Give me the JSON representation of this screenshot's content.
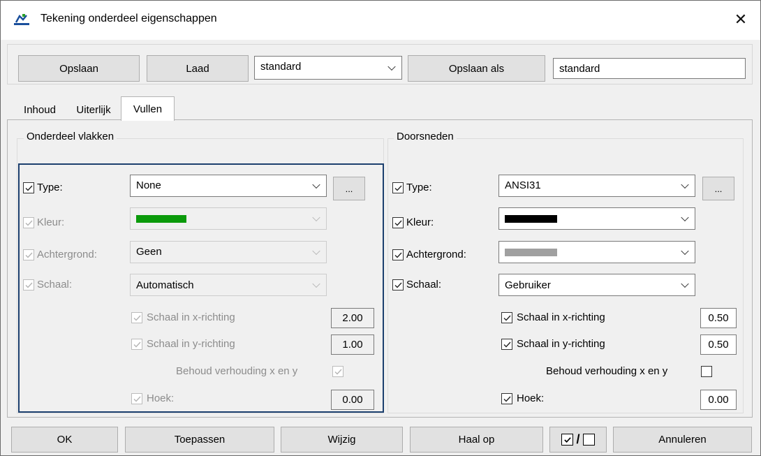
{
  "window": {
    "title": "Tekening onderdeel eigenschappen",
    "close_glyph": "✕"
  },
  "toolbar": {
    "save_label": "Opslaan",
    "load_label": "Laad",
    "profile_select": "standard",
    "save_as_label": "Opslaan als",
    "save_as_name": "standard"
  },
  "tabs": [
    {
      "label": "Inhoud"
    },
    {
      "label": "Uiterlijk"
    },
    {
      "label": "Vullen",
      "active": true
    }
  ],
  "left": {
    "legend": "Onderdeel vlakken",
    "type": {
      "label": "Type:",
      "checked": true,
      "value": "None",
      "more": "..."
    },
    "color": {
      "label": "Kleur:",
      "checked": true,
      "swatch": "#0a9a0a"
    },
    "background": {
      "label": "Achtergrond:",
      "checked": true,
      "value": "Geen"
    },
    "scale": {
      "label": "Schaal:",
      "checked": true,
      "value": "Automatisch"
    },
    "scale_x": {
      "label": "Schaal in x-richting",
      "checked": true,
      "value": "2.00"
    },
    "scale_y": {
      "label": "Schaal in y-richting",
      "checked": true,
      "value": "1.00"
    },
    "keep_ratio": {
      "label": "Behoud verhouding x en y",
      "checked": true
    },
    "angle": {
      "label": "Hoek:",
      "checked": true,
      "value": "0.00"
    }
  },
  "right": {
    "legend": "Doorsneden",
    "type": {
      "label": "Type:",
      "checked": true,
      "value": "ANSI31",
      "more": "..."
    },
    "color": {
      "label": "Kleur:",
      "checked": true,
      "swatch": "#000000"
    },
    "background": {
      "label": "Achtergrond:",
      "checked": true,
      "swatch": "#a0a0a0"
    },
    "scale": {
      "label": "Schaal:",
      "checked": true,
      "value": "Gebruiker"
    },
    "scale_x": {
      "label": "Schaal in x-richting",
      "checked": true,
      "value": "0.50"
    },
    "scale_y": {
      "label": "Schaal in y-richting",
      "checked": true,
      "value": "0.50"
    },
    "keep_ratio": {
      "label": "Behoud verhouding x en y",
      "checked": false
    },
    "angle": {
      "label": "Hoek:",
      "checked": true,
      "value": "0.00"
    }
  },
  "footer": {
    "ok_label": "OK",
    "apply_label": "Toepassen",
    "modify_label": "Wijzig",
    "fetch_label": "Haal op",
    "toggle_slash": "/",
    "cancel_label": "Annuleren"
  },
  "colors": {
    "highlight_border": "#1c3f6e",
    "disabled_text": "#8c8c8c"
  }
}
